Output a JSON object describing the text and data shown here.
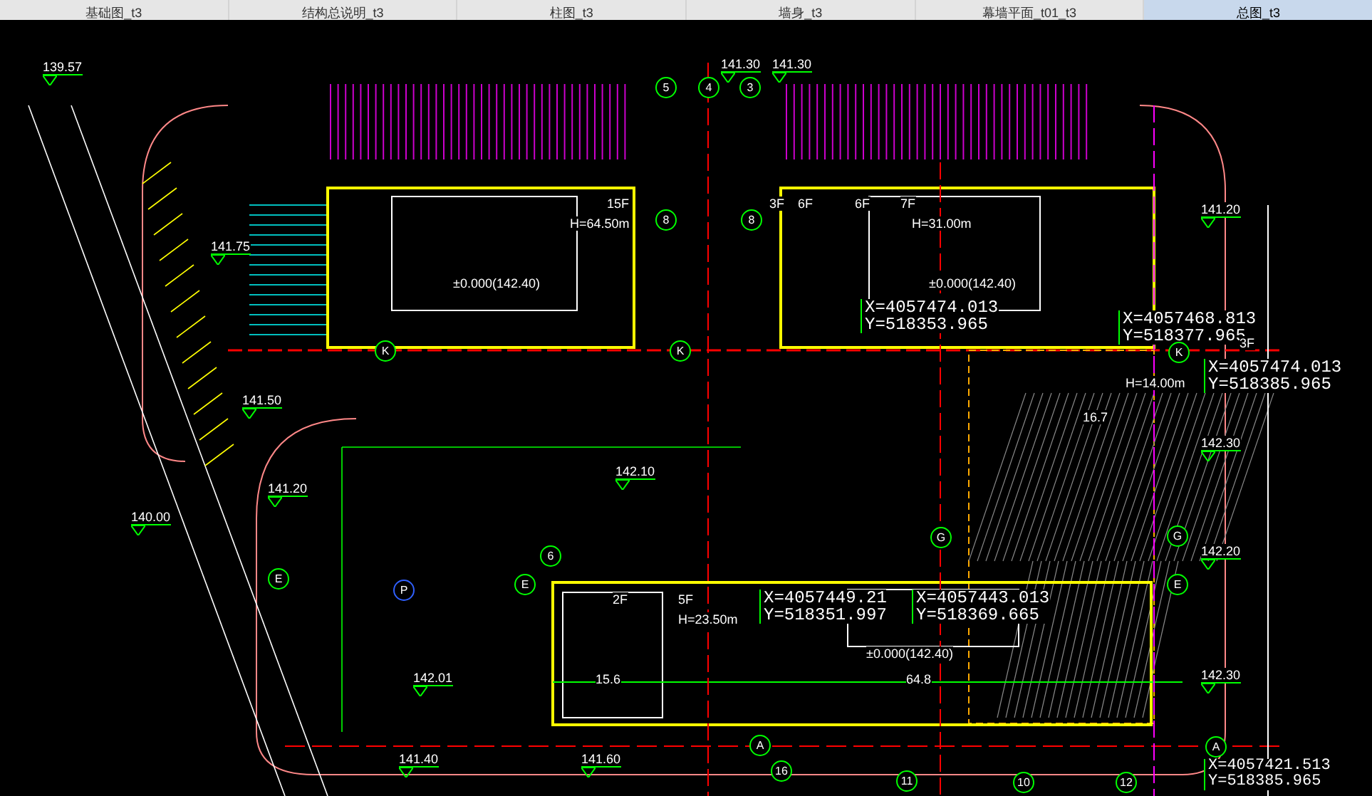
{
  "tabs": [
    {
      "label": "基础图_t3",
      "selected": false
    },
    {
      "label": "结构总说明_t3",
      "selected": false
    },
    {
      "label": "柱图_t3",
      "selected": false
    },
    {
      "label": "墙身_t3",
      "selected": false
    },
    {
      "label": "幕墙平面_t01_t3",
      "selected": false
    },
    {
      "label": "总图_t3",
      "selected": true
    }
  ],
  "elevations": [
    {
      "text": "139.57"
    },
    {
      "text": "141.30"
    },
    {
      "text": "141.30"
    },
    {
      "text": "141.75"
    },
    {
      "text": "141.50"
    },
    {
      "text": "141.20"
    },
    {
      "text": "140.00"
    },
    {
      "text": "142.10"
    },
    {
      "text": "141.20"
    },
    {
      "text": "142.30"
    },
    {
      "text": "142.20"
    },
    {
      "text": "142.30"
    },
    {
      "text": "141.40"
    },
    {
      "text": "141.60"
    },
    {
      "text": "142.01"
    }
  ],
  "coordinates": [
    {
      "line_1": "X=4057474.013",
      "line_2": "Y=518353.965"
    },
    {
      "line_1": "X=4057468.813",
      "line_2": "Y=518377.965"
    },
    {
      "line_1": "X=4057474.013",
      "line_2": "Y=518385.965"
    },
    {
      "line_1": "X=4057449.21",
      "line_2": "Y=518351.997"
    },
    {
      "line_1": "X=4057443.013",
      "line_2": "Y=518369.665"
    },
    {
      "line_1": "X=4057421.513",
      "line_2": "Y=518385.965"
    }
  ],
  "building_labels": [
    {
      "text": "15F"
    },
    {
      "text": "H=64.50m"
    },
    {
      "text": "±0.000(142.40)"
    },
    {
      "text": "3F"
    },
    {
      "text": "6F"
    },
    {
      "text": "6F"
    },
    {
      "text": "7F"
    },
    {
      "text": "H=31.00m"
    },
    {
      "text": "±0.000(142.40)"
    },
    {
      "text": "3F"
    },
    {
      "text": "H=14.00m"
    },
    {
      "text": "16.7"
    },
    {
      "text": "2F"
    },
    {
      "text": "5F"
    },
    {
      "text": "H=23.50m"
    },
    {
      "text": "±0.000(142.40)"
    },
    {
      "text": "15.6"
    },
    {
      "text": "64.8"
    }
  ],
  "axis_bubbles": [
    {
      "text": "5",
      "color": "#00ff00"
    },
    {
      "text": "4",
      "color": "#00ff00"
    },
    {
      "text": "3",
      "color": "#00ff00"
    },
    {
      "text": "8",
      "color": "#00ff00"
    },
    {
      "text": "8",
      "color": "#00ff00"
    },
    {
      "text": "K",
      "color": "#00ff00"
    },
    {
      "text": "K",
      "color": "#00ff00"
    },
    {
      "text": "K",
      "color": "#00ff00"
    },
    {
      "text": "G",
      "color": "#00ff00"
    },
    {
      "text": "G",
      "color": "#00ff00"
    },
    {
      "text": "6",
      "color": "#00ff00"
    },
    {
      "text": "E",
      "color": "#00ff00"
    },
    {
      "text": "E",
      "color": "#00ff00"
    },
    {
      "text": "E",
      "color": "#00ff00"
    },
    {
      "text": "P",
      "color": "#3060ff"
    },
    {
      "text": "A",
      "color": "#00ff00"
    },
    {
      "text": "A",
      "color": "#00ff00"
    },
    {
      "text": "16",
      "color": "#00ff00"
    },
    {
      "text": "11",
      "color": "#00ff00"
    },
    {
      "text": "10",
      "color": "#00ff00"
    },
    {
      "text": "12",
      "color": "#00ff00"
    }
  ]
}
